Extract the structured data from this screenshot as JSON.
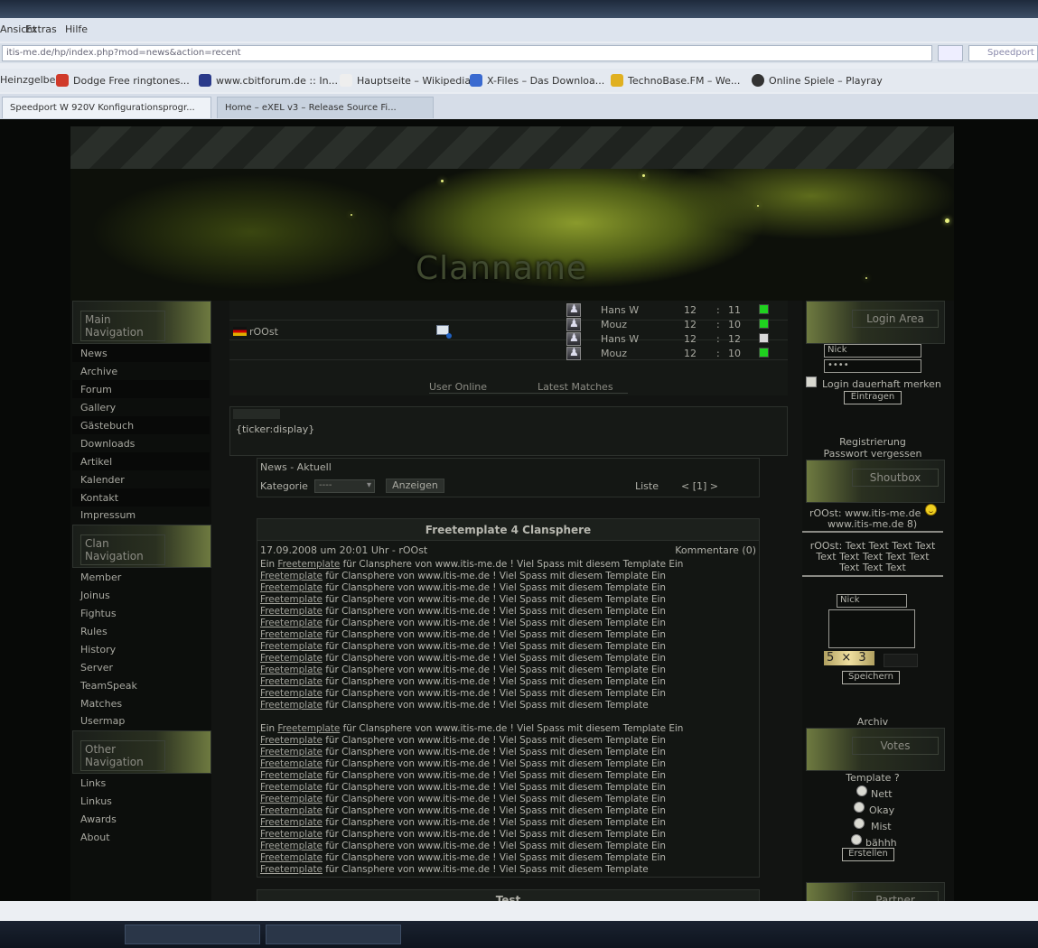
{
  "browser": {
    "menu": [
      "Ansicht",
      "Extras",
      "Hilfe"
    ],
    "url": "itis-me.de/hp/index.php?mod=news&action=recent",
    "search_placeholder": "Speedport",
    "bookmarks": [
      "Heinzgelbe...",
      "Dodge Free ringtones...",
      "www.cbitforum.de :: In...",
      "Hauptseite – Wikipedia",
      "X-Files – Das Downloa...",
      "TechnoBase.FM – We...",
      "Online Spiele – Playray"
    ],
    "tabs": [
      "Speedport W 920V Konfigurationsprogr...",
      "Home – eXEL v3 – Release Source Fi..."
    ]
  },
  "site": {
    "clan_title": "Clanname",
    "main_navigation": {
      "title": "Main Navigation",
      "items": [
        "News",
        "Archive",
        "Forum",
        "Gallery",
        "Gästebuch",
        "Downloads",
        "Artikel",
        "Kalender",
        "Kontakt",
        "Impressum"
      ]
    },
    "clan_navigation": {
      "title": "Clan Navigation",
      "items": [
        "Member",
        "Joinus",
        "Fightus",
        "Rules",
        "History",
        "Server",
        "TeamSpeak",
        "Matches",
        "Usermap"
      ]
    },
    "other_navigation": {
      "title": "Other Navigation",
      "items": [
        "Links",
        "Linkus",
        "Awards",
        "About"
      ]
    },
    "user_online": {
      "label": "User Online",
      "user": "rOOst"
    },
    "latest_matches": {
      "label": "Latest Matches",
      "rows": [
        {
          "name": "Hans W",
          "score1": "12",
          "sep": ":",
          "score2": "11",
          "status": "win"
        },
        {
          "name": "Mouz",
          "score1": "12",
          "sep": ":",
          "score2": "10",
          "status": "win"
        },
        {
          "name": "Hans W",
          "score1": "12",
          "sep": ":",
          "score2": "12",
          "status": "draw"
        },
        {
          "name": "Mouz",
          "score1": "12",
          "sep": ":",
          "score2": "10",
          "status": "win"
        }
      ]
    },
    "ticker": {
      "title": "",
      "text": "{ticker:display}"
    },
    "news_filter": {
      "heading": "News - Aktuell",
      "category_label": "Kategorie",
      "category_value": "----",
      "show_button": "Anzeigen",
      "list_label": "Liste",
      "pagination": "< [1] >"
    },
    "article": {
      "title": "Freetemplate 4 Clansphere",
      "meta": "17.09.2008 um 20:01 Uhr - rOOst",
      "comments": "Kommentare (0)",
      "first_line_prefix": "Ein ",
      "link_word": "Freetemplate",
      "line_rest": " für Clansphere von www.itis-me.de ! Viel Spass mit diesem Template Ein",
      "last_line_rest": " für Clansphere von www.itis-me.de ! Viel Spass mit diesem Template"
    },
    "article2_title": "Test",
    "login": {
      "title": "Login Area",
      "nick_value": "Nick",
      "password_value": "••••",
      "remember_label": "Login dauerhaft merken",
      "submit": "Eintragen",
      "register": "Registrierung",
      "forgot": "Passwort vergessen"
    },
    "shoutbox": {
      "title": "Shoutbox",
      "entry1_line1": "rOOst: www.itis-me.de",
      "entry1_line2": "www.itis-me.de 8)",
      "entry2_line1": "rOOst: Text Text Text Text",
      "entry2_line2": "Text Text Text Text Text",
      "entry2_line3": "Text Text Text",
      "nick_value": "Nick",
      "captcha": "5 × 3",
      "save": "Speichern",
      "archive": "Archiv"
    },
    "votes": {
      "title": "Votes",
      "question": "Template ?",
      "options": [
        "Nett",
        "Okay",
        "Mist",
        "bähhh"
      ],
      "submit": "Erstellen"
    },
    "partner_title": "Partner"
  },
  "colors": {
    "accent_green": "#1fd21f",
    "banner_yellow": "#8a9a2c",
    "status_draw": "#d8d8d8"
  }
}
